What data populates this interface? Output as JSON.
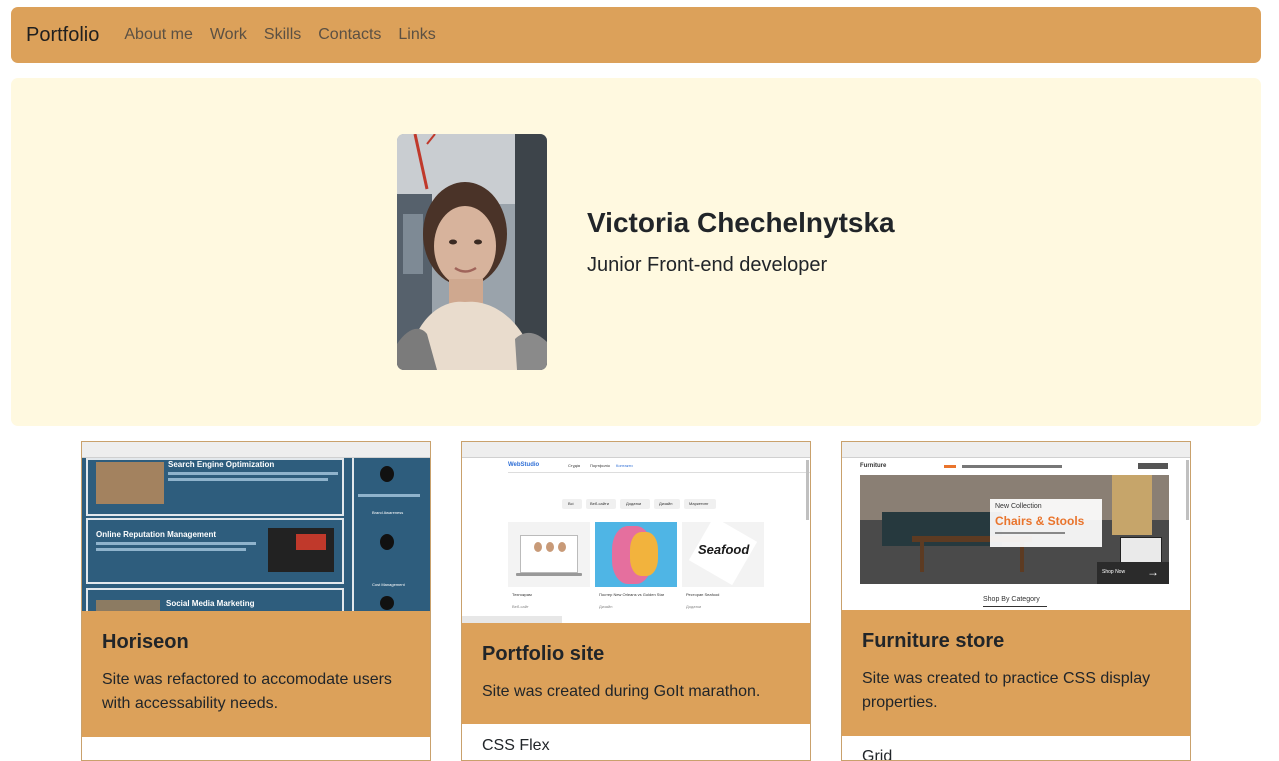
{
  "navbar": {
    "brand": "Portfolio",
    "links": [
      "About me",
      "Work",
      "Skills",
      "Contacts",
      "Links"
    ]
  },
  "hero": {
    "name": "Victoria Chechelnytska",
    "role": "Junior Front-end developer"
  },
  "projects": [
    {
      "title": "Horiseon",
      "description": "Site was refactored to accomodate users with accessability needs.",
      "footer": "",
      "thumbnail": {
        "sections": [
          "Search Engine Optimization",
          "Online Reputation Management",
          "Social Media Marketing"
        ],
        "side_labels": [
          "Brand Awareness",
          "Cost Management"
        ]
      }
    },
    {
      "title": "Portfolio site",
      "description": "Site was created during GoIt marathon.",
      "footer": "CSS Flex",
      "thumbnail": {
        "logo": "WebStudio",
        "menu": [
          "Студія",
          "Портфоліо",
          "Контакти"
        ],
        "filters": [
          "Всі",
          "Веб-сайти",
          "Додатки",
          "Дизайн",
          "Маркетинг"
        ],
        "items": [
          "Технокрам",
          "Постер New Orleans vs Golden Star",
          "Ресторан Seafood"
        ],
        "item_tags": [
          "Веб-сайт",
          "Дизайн",
          "Додатки"
        ],
        "seafood_logo": "Seafood"
      }
    },
    {
      "title": "Furniture store",
      "description": "Site was created to practice CSS display properties.",
      "footer": "Grid",
      "thumbnail": {
        "logo": "Furniture",
        "kicker": "New Collection",
        "headline": "Chairs & Stools",
        "cta": "Shop Now",
        "link": "Shop By Category"
      }
    }
  ],
  "colors": {
    "accent": "#dca15a",
    "hero_bg": "#fff9e0",
    "card_border": "#c9a16c",
    "thumb_blue": "#2e5d7d"
  }
}
